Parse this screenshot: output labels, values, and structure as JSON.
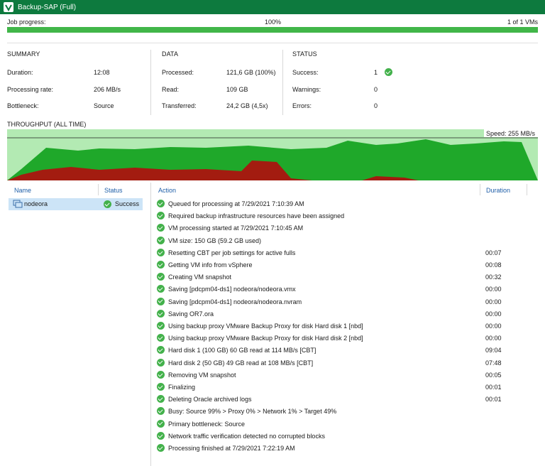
{
  "window": {
    "title": "Backup-SAP (Full)"
  },
  "job": {
    "progress_label": "Job progress:",
    "progress_text": "100%",
    "progress_value": 1.0,
    "vm_count": "1 of 1 VMs"
  },
  "summary": {
    "heading": "SUMMARY",
    "rows": [
      {
        "label": "Duration:",
        "value": "12:08"
      },
      {
        "label": "Processing rate:",
        "value": "206 MB/s"
      },
      {
        "label": "Bottleneck:",
        "value": "Source"
      }
    ]
  },
  "data": {
    "heading": "DATA",
    "rows": [
      {
        "label": "Processed:",
        "value": "121,6 GB (100%)"
      },
      {
        "label": "Read:",
        "value": "109 GB"
      },
      {
        "label": "Transferred:",
        "value": "24,2 GB (4,5x)"
      }
    ]
  },
  "status": {
    "heading": "STATUS",
    "rows": [
      {
        "label": "Success:",
        "value": "1"
      },
      {
        "label": "Warnings:",
        "value": "0"
      },
      {
        "label": "Errors:",
        "value": "0"
      }
    ]
  },
  "throughput": {
    "heading": "THROUGHPUT (ALL TIME)",
    "speed": "Speed: 255 MB/s",
    "colors": {
      "bg": "#b3eab3",
      "read": "#1fa82a",
      "transfer": "#a31c10"
    }
  },
  "vm_list": {
    "columns": {
      "name": "Name",
      "status": "Status"
    },
    "rows": [
      {
        "name": "nodeora",
        "status": "Success",
        "icon": "vm-icon"
      }
    ]
  },
  "actions": {
    "columns": {
      "action": "Action",
      "duration": "Duration"
    },
    "rows": [
      {
        "text": "Queued for processing at 7/29/2021 7:10:39 AM",
        "duration": ""
      },
      {
        "text": "Required backup infrastructure resources have been assigned",
        "duration": ""
      },
      {
        "text": "VM processing started at 7/29/2021 7:10:45 AM",
        "duration": ""
      },
      {
        "text": "VM size: 150 GB (59.2 GB used)",
        "duration": ""
      },
      {
        "text": "Resetting CBT per job settings for active fulls",
        "duration": "00:07"
      },
      {
        "text": "Getting VM info from vSphere",
        "duration": "00:08"
      },
      {
        "text": "Creating VM snapshot",
        "duration": "00:32"
      },
      {
        "text": "Saving [pdcpm04-ds1] nodeora/nodeora.vmx",
        "duration": "00:00"
      },
      {
        "text": "Saving [pdcpm04-ds1] nodeora/nodeora.nvram",
        "duration": "00:00"
      },
      {
        "text": "Saving OR7.ora",
        "duration": "00:00"
      },
      {
        "text": "Using backup proxy VMware Backup Proxy for disk Hard disk 1 [nbd]",
        "duration": "00:00"
      },
      {
        "text": "Using backup proxy VMware Backup Proxy for disk Hard disk 2 [nbd]",
        "duration": "00:00"
      },
      {
        "text": "Hard disk 1 (100 GB) 60 GB read at 114 MB/s [CBT]",
        "duration": "09:04"
      },
      {
        "text": "Hard disk 2 (50 GB) 49 GB read at 108 MB/s [CBT]",
        "duration": "07:48"
      },
      {
        "text": "Removing VM snapshot",
        "duration": "00:05"
      },
      {
        "text": "Finalizing",
        "duration": "00:01"
      },
      {
        "text": "Deleting Oracle archived logs",
        "duration": "00:01"
      },
      {
        "text": "Busy: Source 99% > Proxy 0% > Network 1% > Target 49%",
        "duration": ""
      },
      {
        "text": "Primary bottleneck: Source",
        "duration": ""
      },
      {
        "text": "Network traffic verification detected no corrupted blocks",
        "duration": ""
      },
      {
        "text": "Processing finished at 7/29/2021 7:22:19 AM",
        "duration": ""
      }
    ]
  }
}
